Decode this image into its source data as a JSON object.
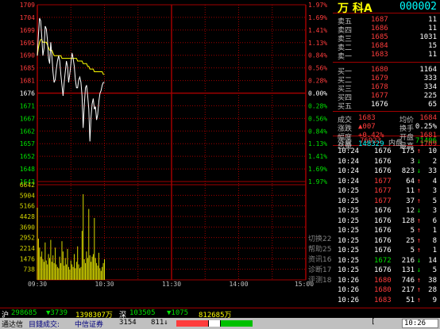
{
  "colors": {
    "background": "#000000",
    "grid": "#a00000",
    "up": "#ff3c3c",
    "down": "#00e000",
    "neutral": "#ffffff",
    "price_line": "#ffffff",
    "avg_line": "#ffff00",
    "volume": "#d8d800",
    "label": "#c0c0c0",
    "cyan": "#00ffff"
  },
  "chart": {
    "price_labels_left": [
      "1709",
      "1704",
      "1699",
      "1695",
      "1690",
      "1685",
      "1681",
      "1676",
      "1671",
      "1667",
      "1662",
      "1657",
      "1652",
      "1648",
      "1643"
    ],
    "pct_labels_right": [
      "1.97%",
      "1.69%",
      "1.41%",
      "1.13%",
      "0.84%",
      "0.56%",
      "0.28%",
      "0.00%",
      "0.28%",
      "0.56%",
      "0.84%",
      "1.13%",
      "1.41%",
      "1.69%",
      "1.97%"
    ],
    "volume_labels": [
      "6642",
      "5904",
      "5166",
      "4428",
      "3690",
      "2952",
      "2214",
      "1476",
      "738"
    ],
    "time_labels": [
      "09:30",
      "10:30",
      "11:30",
      "14:00",
      "15:00"
    ],
    "prev_close": 1676,
    "price_min": 1643,
    "price_max": 1709,
    "volume_max": 7380,
    "session_minutes": 240,
    "price_series": [
      1690,
      1698,
      1704,
      1703,
      1697,
      1690,
      1693,
      1701,
      1700,
      1696,
      1689,
      1687,
      1695,
      1690,
      1684,
      1680,
      1681,
      1685,
      1688,
      1690,
      1688,
      1683,
      1679,
      1675,
      1680,
      1684,
      1688,
      1686,
      1680,
      1683,
      1687,
      1691,
      1689,
      1686,
      1681,
      1678,
      1678,
      1681,
      1682,
      1680,
      1675,
      1663,
      1672,
      1678,
      1679,
      1675,
      1670,
      1658,
      1667,
      1672,
      1674,
      1670,
      1671,
      1666,
      1668,
      1673,
      1676,
      1677,
      1679,
      1680,
      1680
    ],
    "avg_series": [
      1690,
      1693,
      1695,
      1696,
      1696,
      1695,
      1695,
      1695,
      1695,
      1694,
      1693,
      1692,
      1692,
      1692,
      1691,
      1690,
      1690,
      1690,
      1690,
      1690,
      1690,
      1690,
      1689,
      1689,
      1689,
      1689,
      1689,
      1689,
      1689,
      1689,
      1689,
      1689,
      1689,
      1689,
      1689,
      1689,
      1688,
      1688,
      1688,
      1688,
      1688,
      1687,
      1687,
      1687,
      1687,
      1686,
      1686,
      1685,
      1685,
      1685,
      1685,
      1684,
      1684,
      1684,
      1684,
      1684,
      1684,
      1684,
      1684,
      1683,
      1683
    ],
    "volume_series": [
      5600,
      3200,
      2500,
      1800,
      2200,
      1600,
      1400,
      2900,
      1500,
      1200,
      2000,
      1700,
      3100,
      1400,
      1900,
      1300,
      2500,
      1200,
      1000,
      900,
      1800,
      1300,
      3000,
      2200,
      1100,
      1700,
      1200,
      2400,
      1000,
      800,
      1500,
      1200,
      1000,
      2000,
      900,
      1400,
      2600,
      1200,
      900,
      1000,
      3800,
      6642,
      1600,
      1300,
      2200,
      1700,
      5500,
      1900,
      1400,
      1800,
      2000,
      4800,
      1700,
      1300,
      1100,
      2100,
      900,
      700,
      1000,
      1300,
      1600
    ],
    "side_menu": [
      "切换22",
      "帮助25",
      "资讯16",
      "诊断17",
      "评测18"
    ]
  },
  "quote": {
    "name": "万 科A",
    "code": "000002",
    "sells": [
      {
        "label": "卖五",
        "price": "1687",
        "vol": "11"
      },
      {
        "label": "卖四",
        "price": "1686",
        "vol": "11"
      },
      {
        "label": "卖三",
        "price": "1685",
        "vol": "1031"
      },
      {
        "label": "卖二",
        "price": "1684",
        "vol": "15"
      },
      {
        "label": "卖一",
        "price": "1683",
        "vol": "11"
      }
    ],
    "buys": [
      {
        "label": "买一",
        "price": "1680",
        "vol": "1164"
      },
      {
        "label": "买二",
        "price": "1679",
        "vol": "333"
      },
      {
        "label": "买三",
        "price": "1678",
        "vol": "334"
      },
      {
        "label": "买四",
        "price": "1677",
        "vol": "225"
      },
      {
        "label": "买五",
        "price": "1676",
        "vol": "65"
      }
    ],
    "stats": [
      {
        "l1": "成交",
        "v1": "1683",
        "l2": "均价",
        "v2": "1684"
      },
      {
        "l1": "涨跌",
        "v1": "▲007",
        "l2": "换手",
        "v2": "0.25%"
      },
      {
        "l1": "幅度",
        "v1": "+0.42%",
        "l2": "开盘",
        "v2": "1681"
      },
      {
        "l1": "总量",
        "v1": "148329",
        "l2": "最高",
        "v2": "1709"
      }
    ],
    "waipan_label": "外盘",
    "waipan": "76923",
    "neipan_label": "内盘",
    "neipan": "71406",
    "ticks": [
      {
        "t": "10:24",
        "p": "1676",
        "v": "175",
        "d": "↑",
        "n": "10"
      },
      {
        "t": "10:24",
        "p": "1676",
        "v": "3",
        "d": "↓",
        "n": "2"
      },
      {
        "t": "10:24",
        "p": "1676",
        "v": "823",
        "d": "↓",
        "n": "33"
      },
      {
        "t": "10:24",
        "p": "1677",
        "v": "64",
        "d": "↑",
        "n": "4"
      },
      {
        "t": "10:25",
        "p": "1677",
        "v": "11",
        "d": "↑",
        "n": "3"
      },
      {
        "t": "10:25",
        "p": "1677",
        "v": "37",
        "d": "↑",
        "n": "5"
      },
      {
        "t": "10:25",
        "p": "1676",
        "v": "12",
        "d": "↓",
        "n": "3"
      },
      {
        "t": "10:25",
        "p": "1676",
        "v": "128",
        "d": "↑",
        "n": "6"
      },
      {
        "t": "10:25",
        "p": "1676",
        "v": "5",
        "d": "↑",
        "n": "1"
      },
      {
        "t": "10:25",
        "p": "1676",
        "v": "25",
        "d": "↑",
        "n": "8"
      },
      {
        "t": "10:25",
        "p": "1676",
        "v": "5",
        "d": "↑",
        "n": "1"
      },
      {
        "t": "10:25",
        "p": "1672",
        "v": "216",
        "d": "↓",
        "n": "14"
      },
      {
        "t": "10:25",
        "p": "1676",
        "v": "131",
        "d": "↓",
        "n": "5"
      },
      {
        "t": "10:26",
        "p": "1680",
        "v": "746",
        "d": "↑",
        "n": "38"
      },
      {
        "t": "10:26",
        "p": "1680",
        "v": "217",
        "d": "↑",
        "n": "28"
      },
      {
        "t": "10:26",
        "p": "1683",
        "v": "51",
        "d": "↑",
        "n": "9"
      }
    ]
  },
  "footer": {
    "sh_label": "沪",
    "sh_index": "298685",
    "sh_change": "▼3739",
    "sh_amount": "1398307万",
    "sz_label": "深",
    "sz_index": "103505",
    "sz_change": "▼1075",
    "sz_amount": "812685万",
    "app_name": "通达信",
    "mode": "目錢成交:",
    "broker": "中信证券",
    "v1": "3154",
    "v2": "811↓",
    "clock": "10:26"
  }
}
